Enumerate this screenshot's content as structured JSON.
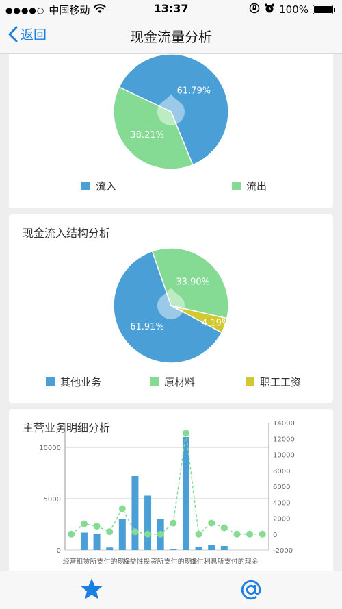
{
  "status_bar": {
    "signal_dots": "●●●●○",
    "carrier": "中国移动",
    "time": "13:37",
    "battery": "100%",
    "icons": [
      "wifi-icon",
      "rotation-lock-icon",
      "alarm-icon",
      "battery-icon"
    ]
  },
  "nav": {
    "back_label": "返回",
    "title": "现金流量分析"
  },
  "colors": {
    "blue": "#4a9fd6",
    "green": "#86db94",
    "yellow": "#d2c830",
    "accent": "#1a7fe0"
  },
  "card1": {
    "legend": [
      "流入",
      "流出"
    ]
  },
  "card2": {
    "title": "现金流入结构分析",
    "legend": [
      "其他业务",
      "原材料",
      "职工工资"
    ]
  },
  "card3": {
    "title": "主营业务明细分析"
  },
  "chart_data": [
    {
      "type": "pie",
      "slices": [
        {
          "label": "流入",
          "value": 61.79,
          "label_text": "61.79%"
        },
        {
          "label": "流出",
          "value": 38.21,
          "label_text": "38.21%"
        }
      ]
    },
    {
      "type": "pie",
      "title": "现金流入结构分析",
      "slices": [
        {
          "label": "其他业务",
          "value": 61.91,
          "label_text": "61.91%"
        },
        {
          "label": "原材料",
          "value": 33.9,
          "label_text": "33.90%"
        },
        {
          "label": "职工工资",
          "value": 4.19,
          "label_text": "4.19%"
        }
      ]
    },
    {
      "type": "bar",
      "title": "主营业务明细分析",
      "x_tick_labels": [
        "经营租赁所支付的现金",
        "权益性投资所支付的现金",
        "偿付利息所支付的现金"
      ],
      "left_axis": {
        "ticks": [
          "0",
          "5000",
          "10000"
        ],
        "ylim": [
          0,
          10000
        ]
      },
      "right_axis": {
        "ticks": [
          "-2000",
          "0",
          "2000",
          "4000",
          "6000",
          "8000",
          "10000",
          "12000",
          "14000"
        ],
        "ylim": [
          -2000,
          14000
        ]
      },
      "grid": true,
      "bars": [
        0,
        1700,
        1600,
        250,
        3000,
        7200,
        5300,
        3000,
        100,
        11000,
        300,
        500,
        400,
        0,
        0,
        0
      ],
      "line": [
        0,
        1300,
        1000,
        300,
        3200,
        300,
        0,
        0,
        1400,
        12700,
        0,
        1400,
        800,
        0,
        0,
        0
      ]
    }
  ]
}
